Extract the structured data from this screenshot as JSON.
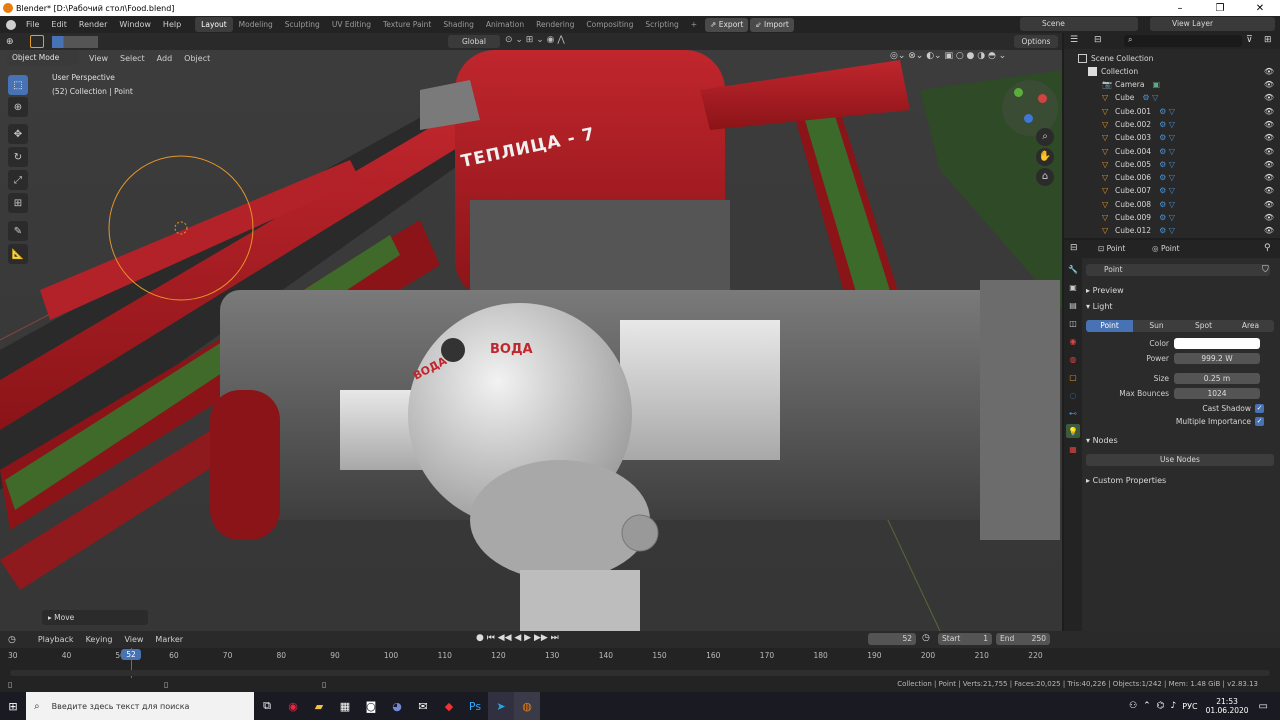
{
  "window": {
    "title": "Blender* [D:\\Рабочий стол\\Food.blend]",
    "min": "–",
    "max": "❐",
    "close": "✕"
  },
  "menus": [
    "File",
    "Edit",
    "Render",
    "Window",
    "Help"
  ],
  "workspaces": [
    "Layout",
    "Modeling",
    "Sculpting",
    "UV Editing",
    "Texture Paint",
    "Shading",
    "Animation",
    "Rendering",
    "Compositing",
    "Scripting"
  ],
  "active_workspace": "Layout",
  "add_tab": "+",
  "export_label": "Export",
  "import_label": "Import",
  "scene": {
    "label": "Scene",
    "view_layer": "View Layer"
  },
  "viewport_header": {
    "orientation": "Global",
    "options": "Options"
  },
  "viewport_header2": {
    "mode": "Object Mode",
    "view": "View",
    "select": "Select",
    "add": "Add",
    "object": "Object"
  },
  "overlay": {
    "line1": "User Perspective",
    "line2": "(52) Collection | Point"
  },
  "scene_labels": {
    "left": "ВОДА",
    "right": "ВОДА",
    "banner": "ТЕПЛИЦА - 7"
  },
  "move_panel": "Move",
  "outliner": {
    "root": "Scene Collection",
    "collection": "Collection",
    "items": [
      "Camera",
      "Cube",
      "Cube.001",
      "Cube.002",
      "Cube.003",
      "Cube.004",
      "Cube.005",
      "Cube.006",
      "Cube.007",
      "Cube.008",
      "Cube.009",
      "Cube.012"
    ]
  },
  "props": {
    "header_obj": "Point",
    "header_data": "Point",
    "datablock": "Point",
    "preview": "Preview",
    "light": "Light",
    "light_types": [
      "Point",
      "Sun",
      "Spot",
      "Area"
    ],
    "active_type": "Point",
    "color_label": "Color",
    "power_label": "Power",
    "power": "999.2 W",
    "size_label": "Size",
    "size": "0.25 m",
    "bounces_label": "Max Bounces",
    "bounces": "1024",
    "cast_shadow": "Cast Shadow",
    "mult_imp": "Multiple Importance",
    "nodes": "Nodes",
    "use_nodes": "Use Nodes",
    "custom": "Custom Properties"
  },
  "timeline": {
    "playback": "Playback",
    "keying": "Keying",
    "view": "View",
    "marker": "Marker",
    "current": "52",
    "start_label": "Start",
    "start": "1",
    "end_label": "End",
    "end": "250",
    "ticks": [
      "30",
      "40",
      "50",
      "60",
      "70",
      "80",
      "90",
      "100",
      "110",
      "120",
      "130",
      "140",
      "150",
      "160",
      "170",
      "180",
      "190",
      "200",
      "210",
      "220"
    ],
    "cursor": "52"
  },
  "status": "Collection | Point | Verts:21,755 | Faces:20,025 | Tris:40,226 | Objects:1/242 | Mem: 1.48 GiB | v2.83.13",
  "taskbar": {
    "search": "Введите здесь текст для поиска",
    "lang": "РУС",
    "time": "21:53",
    "date": "01.06.2020"
  }
}
